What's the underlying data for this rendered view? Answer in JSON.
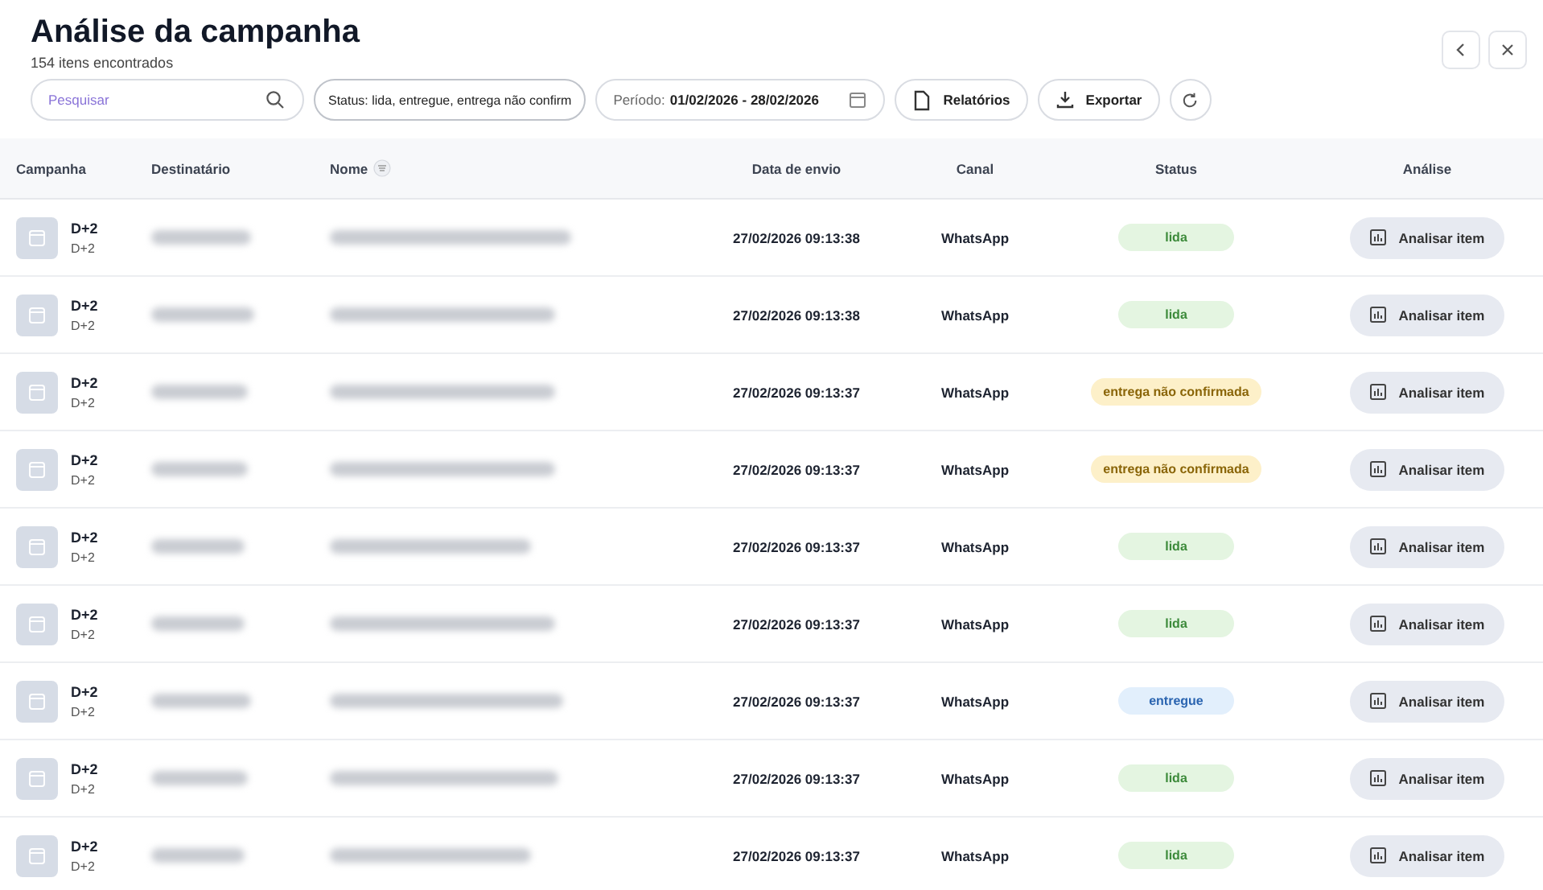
{
  "header": {
    "title": "Análise da campanha",
    "subtitle": "154 itens encontrados"
  },
  "toolbar": {
    "search": {
      "placeholder": "Pesquisar"
    },
    "status_filter": "Status: lida, entregue, entrega não confirm",
    "period": {
      "label": "Período:",
      "value": "01/02/2026 - 28/02/2026"
    },
    "buttons": [
      "Relatórios",
      "Exportar"
    ]
  },
  "table": {
    "columns": [
      "Campanha",
      "Destinatário",
      "Nome",
      "Data de envio",
      "Canal",
      "Status",
      "Análise"
    ],
    "rows": [
      {
        "campaign": "D+2",
        "campaign_sub": "D+2",
        "date": "27/02/2026 09:13:38",
        "channel": "WhatsApp",
        "status": {
          "label": "lida",
          "kind": "read"
        },
        "action": "Analisar item"
      },
      {
        "campaign": "D+2",
        "campaign_sub": "D+2",
        "date": "27/02/2026 09:13:38",
        "channel": "WhatsApp",
        "status": {
          "label": "lida",
          "kind": "read"
        },
        "action": "Analisar item"
      },
      {
        "campaign": "D+2",
        "campaign_sub": "D+2",
        "date": "27/02/2026 09:13:37",
        "channel": "WhatsApp",
        "status": {
          "label": "entrega não confirmada",
          "kind": "unconfirmed"
        },
        "action": "Analisar item"
      },
      {
        "campaign": "D+2",
        "campaign_sub": "D+2",
        "date": "27/02/2026 09:13:37",
        "channel": "WhatsApp",
        "status": {
          "label": "entrega não confirmada",
          "kind": "unconfirmed"
        },
        "action": "Analisar item"
      },
      {
        "campaign": "D+2",
        "campaign_sub": "D+2",
        "date": "27/02/2026 09:13:37",
        "channel": "WhatsApp",
        "status": {
          "label": "lida",
          "kind": "read"
        },
        "action": "Analisar item"
      },
      {
        "campaign": "D+2",
        "campaign_sub": "D+2",
        "date": "27/02/2026 09:13:37",
        "channel": "WhatsApp",
        "status": {
          "label": "lida",
          "kind": "read"
        },
        "action": "Analisar item"
      },
      {
        "campaign": "D+2",
        "campaign_sub": "D+2",
        "date": "27/02/2026 09:13:37",
        "channel": "WhatsApp",
        "status": {
          "label": "entregue",
          "kind": "delivered"
        },
        "action": "Analisar item"
      },
      {
        "campaign": "D+2",
        "campaign_sub": "D+2",
        "date": "27/02/2026 09:13:37",
        "channel": "WhatsApp",
        "status": {
          "label": "lida",
          "kind": "read"
        },
        "action": "Analisar item"
      },
      {
        "campaign": "D+2",
        "campaign_sub": "D+2",
        "date": "27/02/2026 09:13:37",
        "channel": "WhatsApp",
        "status": {
          "label": "lida",
          "kind": "read"
        },
        "action": "Analisar item"
      }
    ]
  }
}
